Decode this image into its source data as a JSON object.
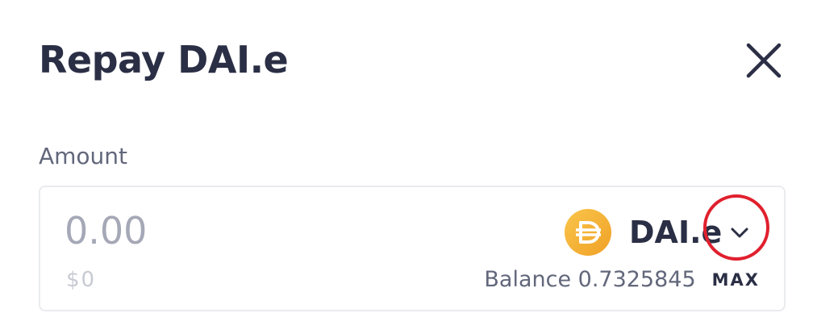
{
  "modal": {
    "title": "Repay DAI.e",
    "close_icon": "close-icon"
  },
  "amount": {
    "label": "Amount",
    "placeholder": "0.00",
    "value": "",
    "usd_value": "$0"
  },
  "token": {
    "symbol": "DAI.e",
    "icon": "dai-token-icon",
    "icon_color": "#f5ac37",
    "dropdown_icon": "chevron-down-icon"
  },
  "balance": {
    "label": "Balance",
    "amount": "0.7325845",
    "text": "Balance 0.7325845",
    "max_label": "MAX"
  },
  "colors": {
    "text_primary": "#2b2f45",
    "text_secondary": "#62677b",
    "placeholder": "#a5a8b6",
    "border": "#eaebef",
    "highlight": "#e0202e"
  }
}
